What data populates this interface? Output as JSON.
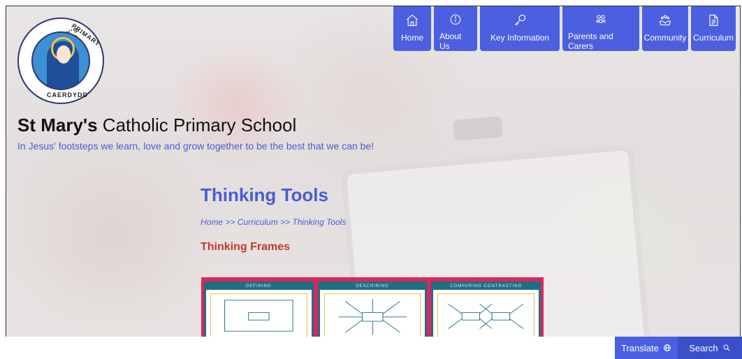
{
  "school": {
    "logo_text_1": "ST MARY'S CATHOLIC",
    "logo_text_2": "PRIMARY",
    "logo_text_3": "CAERDYDD",
    "name_bold": "St Mary's",
    "name_rest": " Catholic Primary School",
    "motto": "In Jesus' footsteps we learn, love and grow together to be the best that we can be!"
  },
  "nav": {
    "items": [
      {
        "label": "Home",
        "icon": "home-icon"
      },
      {
        "label": "About Us",
        "icon": "info-icon"
      },
      {
        "label": "Key Information",
        "icon": "key-icon"
      },
      {
        "label": "Parents and Carers",
        "icon": "family-icon"
      },
      {
        "label": "Community",
        "icon": "hands-icon"
      },
      {
        "label": "Curriculum",
        "icon": "document-icon"
      }
    ],
    "color": "#4b5fe0"
  },
  "page": {
    "title": "Thinking Tools",
    "breadcrumb": "Home >> Curriculum >> Thinking Tools",
    "section_title": "Thinking Frames"
  },
  "frames": [
    {
      "heading": "DEFINING"
    },
    {
      "heading": "DESCRIBING"
    },
    {
      "heading": "COMPARING CONTRASTING"
    }
  ],
  "footer": {
    "translate_label": "Translate",
    "search_label": "Search"
  },
  "colors": {
    "accent": "#4a5bd6",
    "section": "#c0392b",
    "frame_bg": "#e0245e",
    "frame_border": "#1f6f84"
  }
}
